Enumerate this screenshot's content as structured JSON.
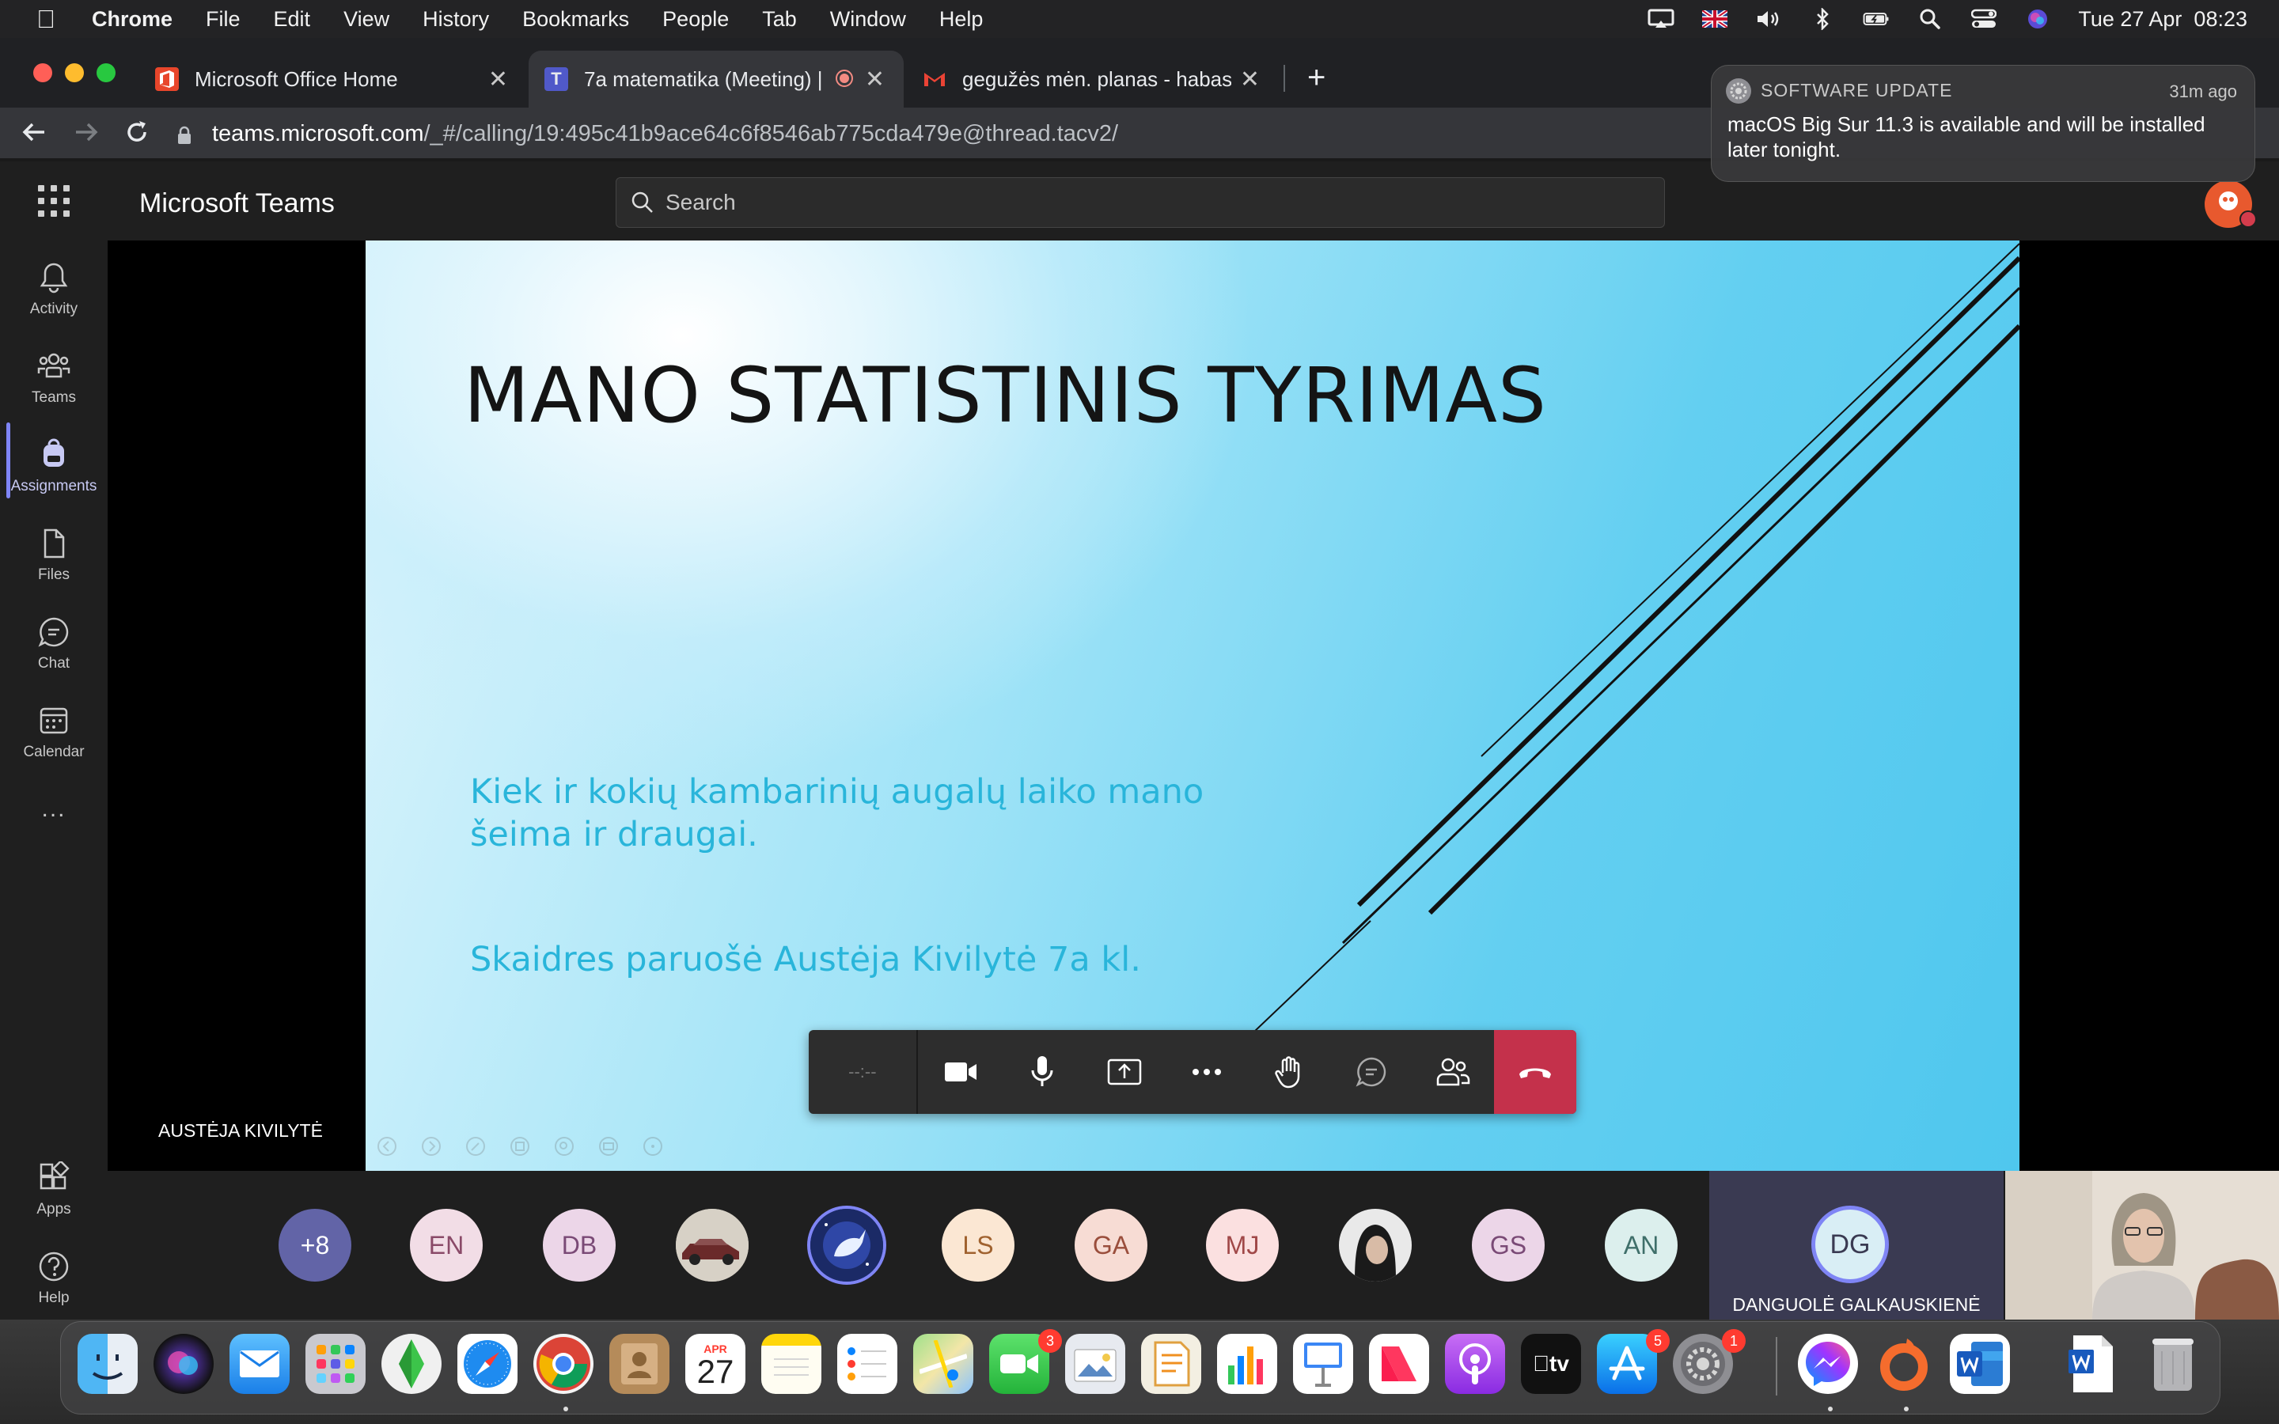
{
  "menubar": {
    "app_name": "Chrome",
    "menus": [
      "File",
      "Edit",
      "View",
      "History",
      "Bookmarks",
      "People",
      "Tab",
      "Window",
      "Help"
    ],
    "clock": "Tue 27 Apr  08:23"
  },
  "browser": {
    "tabs": [
      {
        "title": "Microsoft Office Home",
        "favicon": "office-icon",
        "active": false
      },
      {
        "title": "7a matematika (Meeting) | ",
        "favicon": "teams-icon",
        "active": true,
        "recording": true
      },
      {
        "title": "gegužės mėn. planas - habas.i",
        "favicon": "gmail-icon",
        "active": false
      }
    ],
    "url_host": "teams.microsoft.com",
    "url_path": "/_#/calling/19:495c41b9ace64c6f8546ab775cda479e@thread.tacv2/"
  },
  "notification": {
    "app": "SOFTWARE UPDATE",
    "time": "31m ago",
    "body": "macOS Big Sur 11.3 is available and will be installed later tonight."
  },
  "teams": {
    "title": "Microsoft Teams",
    "search_placeholder": "Search",
    "rail": [
      {
        "label": "Activity",
        "icon": "bell-icon"
      },
      {
        "label": "Teams",
        "icon": "people-icon"
      },
      {
        "label": "Assignments",
        "icon": "backpack-icon",
        "active": true
      },
      {
        "label": "Files",
        "icon": "file-icon"
      },
      {
        "label": "Chat",
        "icon": "chat-icon"
      },
      {
        "label": "Calendar",
        "icon": "calendar-icon"
      }
    ],
    "more_label": "...",
    "apps_label": "Apps",
    "help_label": "Help"
  },
  "slide": {
    "title": "MANO STATISTINIS TYRIMAS",
    "subtitle_line1": "Kiek ir kokių kambarinių augalų laiko mano",
    "subtitle_line2": "šeima ir draugai.",
    "author": "Skaidres paruošė Austėja Kivilytė 7a kl."
  },
  "presenter_name": "AUSTĖJA KIVILYTĖ",
  "call": {
    "timer": "--:--"
  },
  "participants": [
    {
      "initials": "+8",
      "bg": "#6264a7",
      "fg": "#ffffff"
    },
    {
      "initials": "EN",
      "bg": "#f2dde6",
      "fg": "#8a4a68"
    },
    {
      "initials": "DB",
      "bg": "#ecd6e8",
      "fg": "#7a4a76"
    },
    {
      "initials": "",
      "bg": "#c9c3b8",
      "fg": "#333333",
      "photo": "car"
    },
    {
      "initials": "",
      "bg": "#2c3e7a",
      "fg": "#ffffff",
      "photo": "unicorn",
      "speaking": true
    },
    {
      "initials": "LS",
      "bg": "#fbe7d3",
      "fg": "#a0622f"
    },
    {
      "initials": "GA",
      "bg": "#f7dcd4",
      "fg": "#9a4e3c"
    },
    {
      "initials": "MJ",
      "bg": "#fbe0e0",
      "fg": "#a04848"
    },
    {
      "initials": "",
      "bg": "#3a3a3a",
      "fg": "#ffffff",
      "photo": "person"
    },
    {
      "initials": "GS",
      "bg": "#ecd6e8",
      "fg": "#7a4a76"
    },
    {
      "initials": "AN",
      "bg": "#dcefed",
      "fg": "#3f6f6a"
    }
  ],
  "featured": {
    "initials": "DG",
    "name": "DANGUOLĖ GALKAUSKIENĖ"
  },
  "dock": {
    "calendar_month": "APR",
    "calendar_day": "27",
    "facetime_badge": "3",
    "appstore_badge": "5",
    "settings_badge": "1"
  }
}
